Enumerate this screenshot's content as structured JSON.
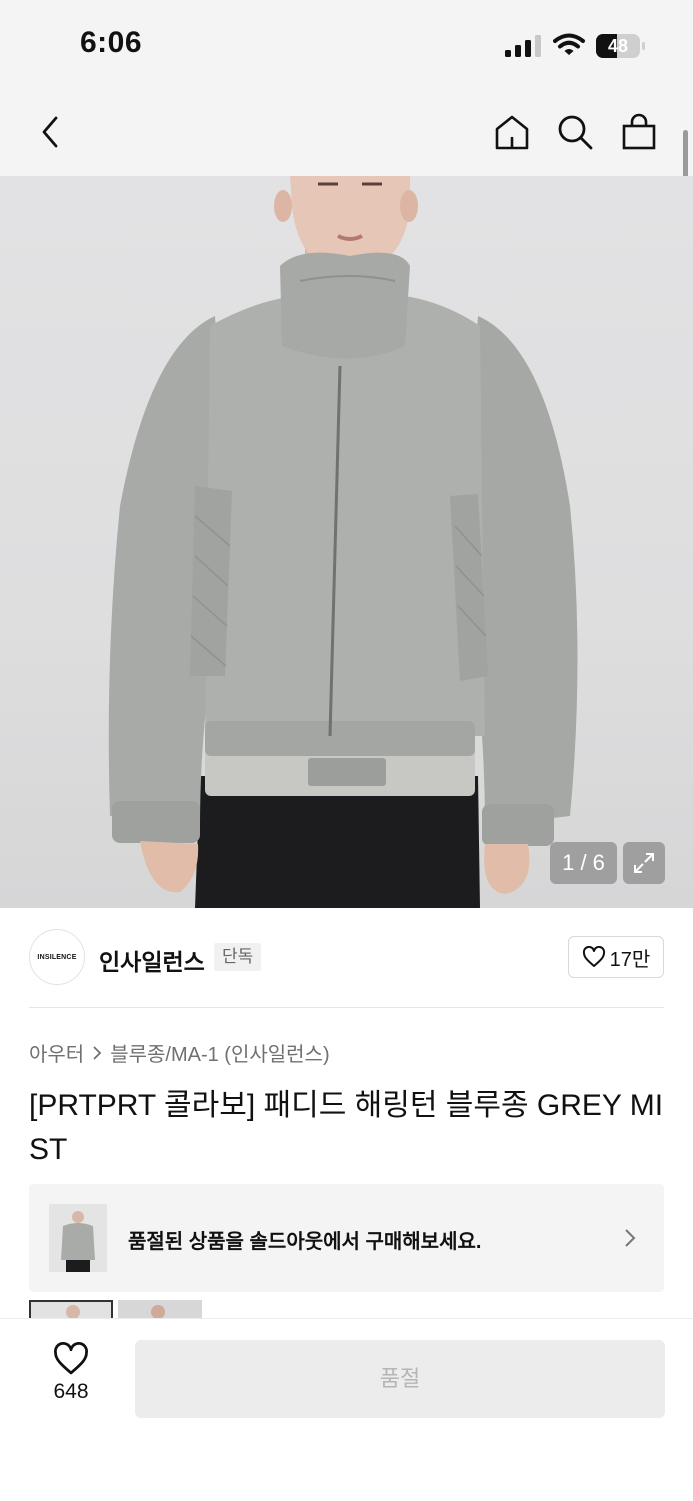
{
  "status_bar": {
    "time": "6:06",
    "battery": "48",
    "battery_level": 0.48
  },
  "nav": {
    "back_icon": "chevron-left-icon",
    "home_icon": "home-icon",
    "search_icon": "search-icon",
    "bag_icon": "shopping-bag-icon"
  },
  "gallery": {
    "counter": "1 / 6",
    "expand_icon": "expand-icon"
  },
  "brand": {
    "logo_text": "INSILENCE",
    "name": "인사일런스",
    "badge": "단독",
    "likes": "17만"
  },
  "breadcrumb": {
    "level1": "아우터",
    "level2": "블루종/MA-1 (인사일런스)"
  },
  "product": {
    "title": "[PRTPRT 콜라보] 패디드 해링턴 블루종 GREY MIST"
  },
  "soldout_banner": {
    "text": "품절된 상품을 솔드아웃에서 구매해보세요."
  },
  "bottom_bar": {
    "wish_count": "648",
    "buy_label": "품절"
  },
  "colors": {
    "background": "#f4f4f4",
    "jacket": "#a9aca8",
    "disabled_button": "#ececec"
  }
}
